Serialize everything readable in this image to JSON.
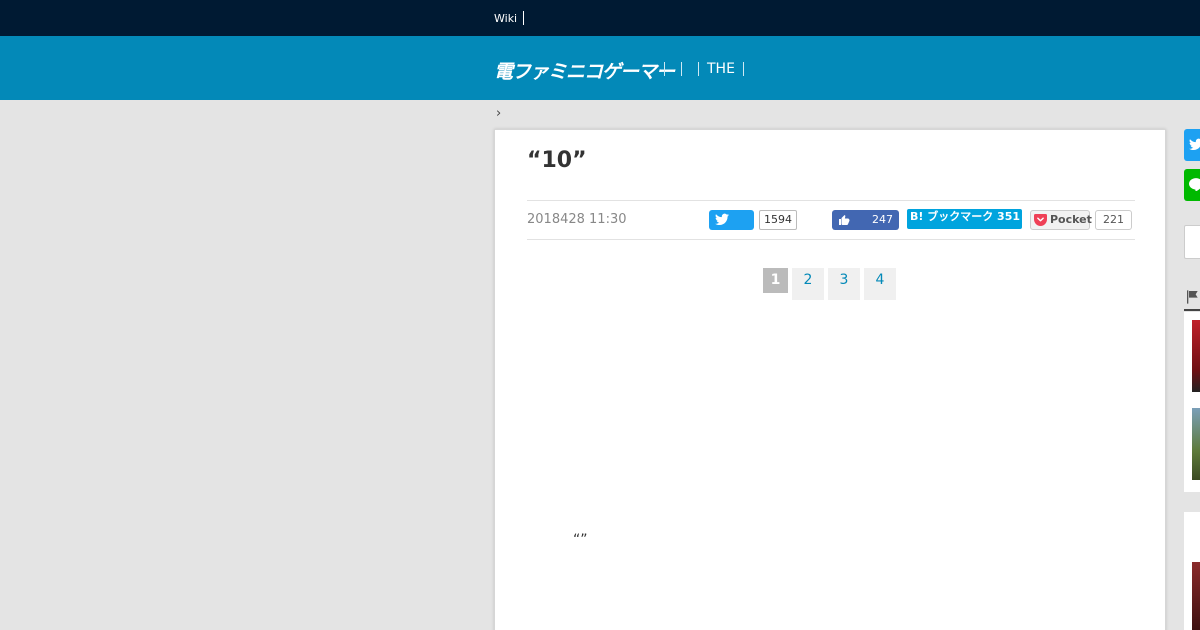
{
  "topbar": {
    "wiki_link": "Wiki"
  },
  "header": {
    "logo_text": "電ファミニコゲーマー",
    "nav_items": [
      "",
      "",
      "THE"
    ]
  },
  "breadcrumb": {
    "separator": "›"
  },
  "article": {
    "title": "“10”",
    "date": "2018428 11:30",
    "quote": "“”"
  },
  "share": {
    "twitter_count": "1594",
    "facebook_count": "247",
    "hatena_label": "B! ブックマーク 351",
    "pocket_label": "Pocket",
    "pocket_count": "221"
  },
  "pagination": {
    "current": "1",
    "pages": [
      "2",
      "3",
      "4"
    ]
  },
  "colors": {
    "topbar": "#001a33",
    "header": "#0389b8",
    "twitter": "#1da1f2",
    "facebook": "#4267b2",
    "hatena": "#00a4de",
    "line": "#00b900"
  }
}
